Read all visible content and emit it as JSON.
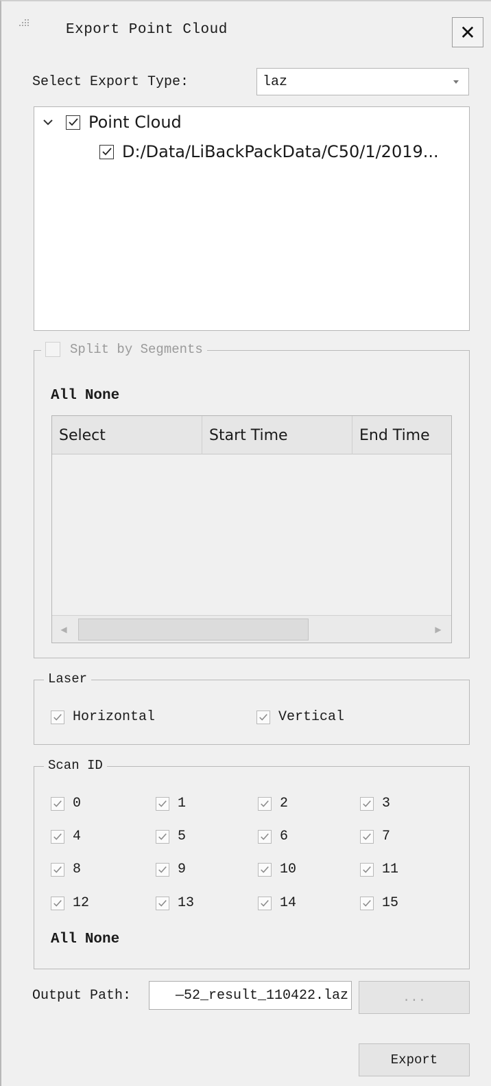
{
  "window": {
    "title": "Export Point Cloud",
    "close_label": "✕"
  },
  "export_type": {
    "label": "Select Export Type:",
    "value": "laz"
  },
  "tree": {
    "root_label": "Point Cloud",
    "root_checked": true,
    "child_label": "D:/Data/LiBackPackData/C50/1/2019...",
    "child_checked": true
  },
  "segments": {
    "legend": "Split by Segments",
    "enabled": false,
    "all_label": "All",
    "none_label": "None",
    "columns": [
      "Select",
      "Start Time",
      "End Time"
    ]
  },
  "laser": {
    "legend": "Laser",
    "options": [
      {
        "label": "Horizontal",
        "checked": true
      },
      {
        "label": "Vertical",
        "checked": true
      }
    ]
  },
  "scan_id": {
    "legend": "Scan ID",
    "ids": [
      "0",
      "1",
      "2",
      "3",
      "4",
      "5",
      "6",
      "7",
      "8",
      "9",
      "10",
      "11",
      "12",
      "13",
      "14",
      "15"
    ],
    "all_label": "All",
    "none_label": "None"
  },
  "output": {
    "label": "Output Path:",
    "value": "—52_result_110422.laz",
    "browse_label": "...",
    "export_label": "Export"
  },
  "colors": {
    "background": "#f0f0f0",
    "field": "#ffffff",
    "border": "#b5b5b5",
    "disabled": "#9a9a9a"
  }
}
